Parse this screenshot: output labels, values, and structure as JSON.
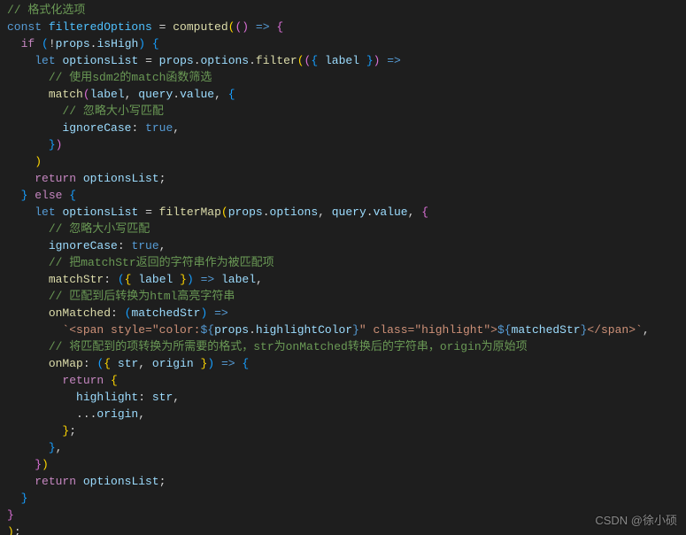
{
  "watermark": "CSDN @徐小硕",
  "lines": [
    [
      {
        "t": "// 格式化选项",
        "c": "comment"
      }
    ],
    [
      {
        "t": "const ",
        "c": "keyword"
      },
      {
        "t": "filteredOptions",
        "c": "const"
      },
      {
        "t": " = ",
        "c": "default"
      },
      {
        "t": "computed",
        "c": "func"
      },
      {
        "t": "(",
        "c": "paren1"
      },
      {
        "t": "(",
        "c": "paren2"
      },
      {
        "t": ")",
        "c": "paren2"
      },
      {
        "t": " ",
        "c": "default"
      },
      {
        "t": "=>",
        "c": "keyword"
      },
      {
        "t": " ",
        "c": "default"
      },
      {
        "t": "{",
        "c": "brace2"
      }
    ],
    [
      {
        "t": "  ",
        "c": "default"
      },
      {
        "t": "if",
        "c": "ctrl"
      },
      {
        "t": " ",
        "c": "default"
      },
      {
        "t": "(",
        "c": "paren3"
      },
      {
        "t": "!",
        "c": "default"
      },
      {
        "t": "props",
        "c": "var"
      },
      {
        "t": ".",
        "c": "default"
      },
      {
        "t": "isHigh",
        "c": "var"
      },
      {
        "t": ")",
        "c": "paren3"
      },
      {
        "t": " ",
        "c": "default"
      },
      {
        "t": "{",
        "c": "brace3"
      }
    ],
    [
      {
        "t": "    ",
        "c": "default"
      },
      {
        "t": "let ",
        "c": "keyword"
      },
      {
        "t": "optionsList",
        "c": "var"
      },
      {
        "t": " = ",
        "c": "default"
      },
      {
        "t": "props",
        "c": "var"
      },
      {
        "t": ".",
        "c": "default"
      },
      {
        "t": "options",
        "c": "var"
      },
      {
        "t": ".",
        "c": "default"
      },
      {
        "t": "filter",
        "c": "func"
      },
      {
        "t": "(",
        "c": "paren1"
      },
      {
        "t": "(",
        "c": "paren2"
      },
      {
        "t": "{",
        "c": "brace3"
      },
      {
        "t": " ",
        "c": "default"
      },
      {
        "t": "label",
        "c": "var"
      },
      {
        "t": " ",
        "c": "default"
      },
      {
        "t": "}",
        "c": "brace3"
      },
      {
        "t": ")",
        "c": "paren2"
      },
      {
        "t": " ",
        "c": "default"
      },
      {
        "t": "=>",
        "c": "keyword"
      }
    ],
    [
      {
        "t": "      ",
        "c": "default"
      },
      {
        "t": "// 使用sdm2的match函数筛选",
        "c": "comment"
      }
    ],
    [
      {
        "t": "      ",
        "c": "default"
      },
      {
        "t": "match",
        "c": "func"
      },
      {
        "t": "(",
        "c": "paren2"
      },
      {
        "t": "label",
        "c": "var"
      },
      {
        "t": ", ",
        "c": "default"
      },
      {
        "t": "query",
        "c": "var"
      },
      {
        "t": ".",
        "c": "default"
      },
      {
        "t": "value",
        "c": "var"
      },
      {
        "t": ", ",
        "c": "default"
      },
      {
        "t": "{",
        "c": "brace3"
      }
    ],
    [
      {
        "t": "        ",
        "c": "default"
      },
      {
        "t": "// 忽略大小写匹配",
        "c": "comment"
      }
    ],
    [
      {
        "t": "        ",
        "c": "default"
      },
      {
        "t": "ignoreCase",
        "c": "var"
      },
      {
        "t": ":",
        "c": "default"
      },
      {
        "t": " ",
        "c": "default"
      },
      {
        "t": "true",
        "c": "keyword"
      },
      {
        "t": ",",
        "c": "default"
      }
    ],
    [
      {
        "t": "      ",
        "c": "default"
      },
      {
        "t": "}",
        "c": "brace3"
      },
      {
        "t": ")",
        "c": "paren2"
      }
    ],
    [
      {
        "t": "    ",
        "c": "default"
      },
      {
        "t": ")",
        "c": "paren1"
      }
    ],
    [
      {
        "t": "    ",
        "c": "default"
      },
      {
        "t": "return",
        "c": "ctrl"
      },
      {
        "t": " ",
        "c": "default"
      },
      {
        "t": "optionsList",
        "c": "var"
      },
      {
        "t": ";",
        "c": "default"
      }
    ],
    [
      {
        "t": "  ",
        "c": "default"
      },
      {
        "t": "}",
        "c": "brace3"
      },
      {
        "t": " ",
        "c": "default"
      },
      {
        "t": "else",
        "c": "ctrl"
      },
      {
        "t": " ",
        "c": "default"
      },
      {
        "t": "{",
        "c": "brace3"
      }
    ],
    [
      {
        "t": "    ",
        "c": "default"
      },
      {
        "t": "let ",
        "c": "keyword"
      },
      {
        "t": "optionsList",
        "c": "var"
      },
      {
        "t": " = ",
        "c": "default"
      },
      {
        "t": "filterMap",
        "c": "func"
      },
      {
        "t": "(",
        "c": "paren1"
      },
      {
        "t": "props",
        "c": "var"
      },
      {
        "t": ".",
        "c": "default"
      },
      {
        "t": "options",
        "c": "var"
      },
      {
        "t": ", ",
        "c": "default"
      },
      {
        "t": "query",
        "c": "var"
      },
      {
        "t": ".",
        "c": "default"
      },
      {
        "t": "value",
        "c": "var"
      },
      {
        "t": ", ",
        "c": "default"
      },
      {
        "t": "{",
        "c": "brace2"
      }
    ],
    [
      {
        "t": "      ",
        "c": "default"
      },
      {
        "t": "// 忽略大小写匹配",
        "c": "comment"
      }
    ],
    [
      {
        "t": "      ",
        "c": "default"
      },
      {
        "t": "ignoreCase",
        "c": "var"
      },
      {
        "t": ":",
        "c": "default"
      },
      {
        "t": " ",
        "c": "default"
      },
      {
        "t": "true",
        "c": "keyword"
      },
      {
        "t": ",",
        "c": "default"
      }
    ],
    [
      {
        "t": "      ",
        "c": "default"
      },
      {
        "t": "// 把matchStr返回的字符串作为被匹配项",
        "c": "comment"
      }
    ],
    [
      {
        "t": "      ",
        "c": "default"
      },
      {
        "t": "matchStr",
        "c": "func"
      },
      {
        "t": ":",
        "c": "default"
      },
      {
        "t": " ",
        "c": "default"
      },
      {
        "t": "(",
        "c": "paren3"
      },
      {
        "t": "{",
        "c": "brace1"
      },
      {
        "t": " ",
        "c": "default"
      },
      {
        "t": "label",
        "c": "var"
      },
      {
        "t": " ",
        "c": "default"
      },
      {
        "t": "}",
        "c": "brace1"
      },
      {
        "t": ")",
        "c": "paren3"
      },
      {
        "t": " ",
        "c": "default"
      },
      {
        "t": "=>",
        "c": "keyword"
      },
      {
        "t": " ",
        "c": "default"
      },
      {
        "t": "label",
        "c": "var"
      },
      {
        "t": ",",
        "c": "default"
      }
    ],
    [
      {
        "t": "      ",
        "c": "default"
      },
      {
        "t": "// 匹配到后转换为html高亮字符串",
        "c": "comment"
      }
    ],
    [
      {
        "t": "      ",
        "c": "default"
      },
      {
        "t": "onMatched",
        "c": "func"
      },
      {
        "t": ":",
        "c": "default"
      },
      {
        "t": " ",
        "c": "default"
      },
      {
        "t": "(",
        "c": "paren3"
      },
      {
        "t": "matchedStr",
        "c": "var"
      },
      {
        "t": ")",
        "c": "paren3"
      },
      {
        "t": " ",
        "c": "default"
      },
      {
        "t": "=>",
        "c": "keyword"
      }
    ],
    [
      {
        "t": "        ",
        "c": "default"
      },
      {
        "t": "`<span style=\"color:",
        "c": "string"
      },
      {
        "t": "${",
        "c": "keyword"
      },
      {
        "t": "props",
        "c": "var"
      },
      {
        "t": ".",
        "c": "default"
      },
      {
        "t": "highlightColor",
        "c": "var"
      },
      {
        "t": "}",
        "c": "keyword"
      },
      {
        "t": "\" class=\"highlight\">",
        "c": "string"
      },
      {
        "t": "${",
        "c": "keyword"
      },
      {
        "t": "matchedStr",
        "c": "var"
      },
      {
        "t": "}",
        "c": "keyword"
      },
      {
        "t": "</span>`",
        "c": "string"
      },
      {
        "t": ",",
        "c": "default"
      }
    ],
    [
      {
        "t": "      ",
        "c": "default"
      },
      {
        "t": "// 将匹配到的项转换为所需要的格式，str为onMatched转换后的字符串，origin为原始项",
        "c": "comment"
      }
    ],
    [
      {
        "t": "      ",
        "c": "default"
      },
      {
        "t": "onMap",
        "c": "func"
      },
      {
        "t": ":",
        "c": "default"
      },
      {
        "t": " ",
        "c": "default"
      },
      {
        "t": "(",
        "c": "paren3"
      },
      {
        "t": "{",
        "c": "brace1"
      },
      {
        "t": " ",
        "c": "default"
      },
      {
        "t": "str",
        "c": "var"
      },
      {
        "t": ", ",
        "c": "default"
      },
      {
        "t": "origin",
        "c": "var"
      },
      {
        "t": " ",
        "c": "default"
      },
      {
        "t": "}",
        "c": "brace1"
      },
      {
        "t": ")",
        "c": "paren3"
      },
      {
        "t": " ",
        "c": "default"
      },
      {
        "t": "=>",
        "c": "keyword"
      },
      {
        "t": " ",
        "c": "default"
      },
      {
        "t": "{",
        "c": "brace3"
      }
    ],
    [
      {
        "t": "        ",
        "c": "default"
      },
      {
        "t": "return",
        "c": "ctrl"
      },
      {
        "t": " ",
        "c": "default"
      },
      {
        "t": "{",
        "c": "brace1"
      }
    ],
    [
      {
        "t": "          ",
        "c": "default"
      },
      {
        "t": "highlight",
        "c": "var"
      },
      {
        "t": ":",
        "c": "default"
      },
      {
        "t": " ",
        "c": "default"
      },
      {
        "t": "str",
        "c": "var"
      },
      {
        "t": ",",
        "c": "default"
      }
    ],
    [
      {
        "t": "          ...",
        "c": "default"
      },
      {
        "t": "origin",
        "c": "var"
      },
      {
        "t": ",",
        "c": "default"
      }
    ],
    [
      {
        "t": "        ",
        "c": "default"
      },
      {
        "t": "}",
        "c": "brace1"
      },
      {
        "t": ";",
        "c": "default"
      }
    ],
    [
      {
        "t": "      ",
        "c": "default"
      },
      {
        "t": "}",
        "c": "brace3"
      },
      {
        "t": ",",
        "c": "default"
      }
    ],
    [
      {
        "t": "    ",
        "c": "default"
      },
      {
        "t": "}",
        "c": "brace2"
      },
      {
        "t": ")",
        "c": "paren1"
      }
    ],
    [
      {
        "t": "    ",
        "c": "default"
      },
      {
        "t": "return",
        "c": "ctrl"
      },
      {
        "t": " ",
        "c": "default"
      },
      {
        "t": "optionsList",
        "c": "var"
      },
      {
        "t": ";",
        "c": "default"
      }
    ],
    [
      {
        "t": "  ",
        "c": "default"
      },
      {
        "t": "}",
        "c": "brace3"
      }
    ],
    [
      {
        "t": "}",
        "c": "brace2"
      }
    ],
    [
      {
        "t": ")",
        "c": "paren1"
      },
      {
        "t": ";",
        "c": "default"
      }
    ]
  ]
}
